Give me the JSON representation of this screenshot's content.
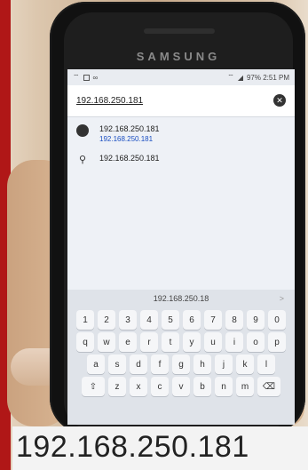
{
  "device": {
    "brand": "SAMSUNG"
  },
  "status_bar": {
    "left_icons": [
      "wifi-calling-icon",
      "square-icon",
      "voicemail-icon"
    ],
    "right_text": "97% 2:51 PM",
    "right_icons": [
      "wifi-icon",
      "signal-icon",
      "battery-icon"
    ]
  },
  "search": {
    "value": "192.168.250.181",
    "clear_icon": "close-circle-icon"
  },
  "results": [
    {
      "icon": "globe-icon",
      "title": "192.168.250.181",
      "url": "192.168.250.181"
    },
    {
      "icon": "search-icon",
      "title": "192.168.250.181"
    }
  ],
  "keyboard": {
    "suggestion": "192.168.250.18",
    "suggestion_arrow": ">",
    "row_numbers": [
      "1",
      "2",
      "3",
      "4",
      "5",
      "6",
      "7",
      "8",
      "9",
      "0"
    ],
    "row_top": [
      "q",
      "w",
      "e",
      "r",
      "t",
      "y",
      "u",
      "i",
      "o",
      "p"
    ],
    "row_middle": [
      "a",
      "s",
      "d",
      "f",
      "g",
      "h",
      "j",
      "k",
      "l"
    ],
    "row_bottom": [
      "⇧",
      "z",
      "x",
      "c",
      "v",
      "b",
      "n",
      "m",
      "⌫"
    ]
  },
  "caption": {
    "text": "192.168.250.181"
  },
  "colors": {
    "accent_red": "#b01717",
    "link_blue": "#1a4ec1"
  }
}
